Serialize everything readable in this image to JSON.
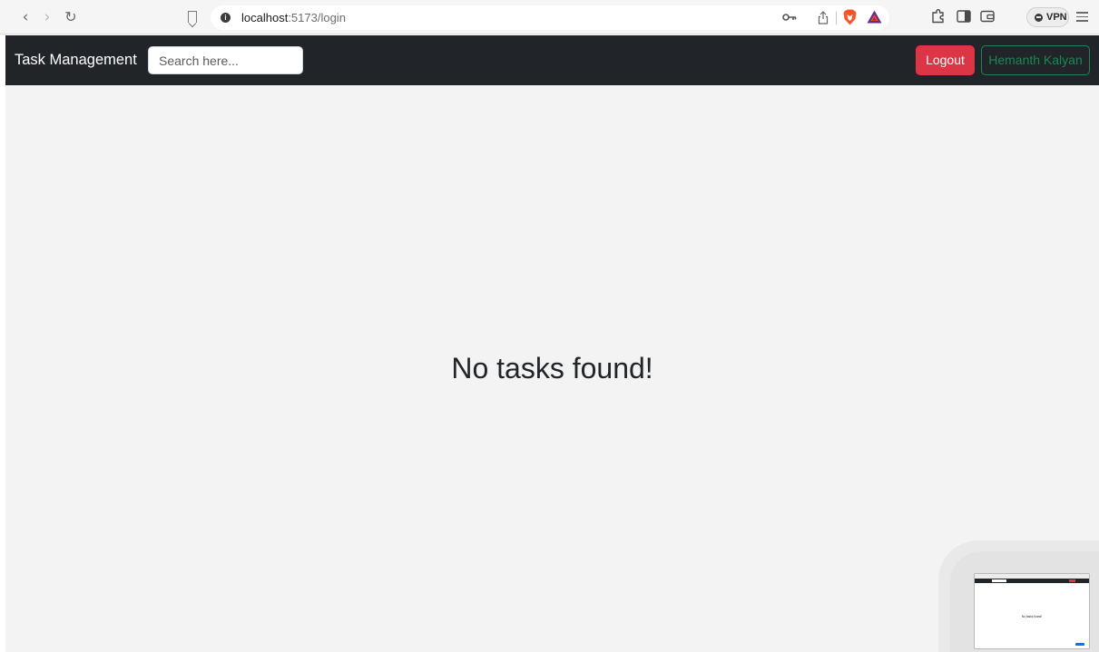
{
  "browser": {
    "url_host": "localhost",
    "url_path": ":5173/login",
    "vpn_label": "VPN",
    "icons": [
      "back-icon",
      "forward-icon",
      "reload-icon",
      "bookmark-icon",
      "site-info-icon",
      "key-icon",
      "share-icon",
      "brave-shields-icon",
      "brave-rewards-icon",
      "extensions-icon",
      "sidebar-icon",
      "wallet-icon",
      "vpn-icon",
      "menu-icon"
    ]
  },
  "navbar": {
    "brand": "Task Management",
    "search_placeholder": "Search here...",
    "logout_label": "Logout",
    "user_label": "Hemanth Kalyan"
  },
  "main": {
    "empty_message": "No tasks found!"
  },
  "colors": {
    "navbar_bg": "#212529",
    "logout_bg": "#dc3545",
    "user_outline": "#198754",
    "page_bg": "#f3f3f3"
  }
}
